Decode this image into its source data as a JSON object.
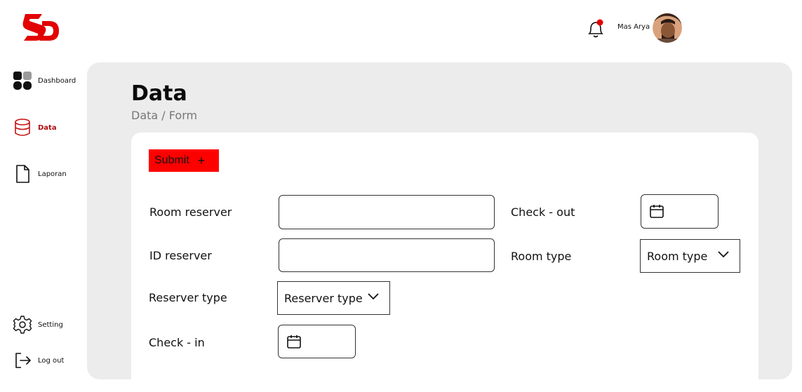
{
  "brand": {
    "logo_icon": "brand-logo",
    "accent": "#e20000"
  },
  "topbar": {
    "bell_icon": "bell-icon",
    "user_name": "Mas Arya",
    "avatar": "avatar"
  },
  "sidebar": {
    "items": [
      {
        "label": "Dashboard",
        "icon": "dashboard-grid-icon",
        "active": false
      },
      {
        "label": "Data",
        "icon": "database-icon",
        "active": true
      },
      {
        "label": "Laporan",
        "icon": "document-icon",
        "active": false
      },
      {
        "label": "Setting",
        "icon": "gear-icon",
        "active": false
      },
      {
        "label": "Log out",
        "icon": "logout-icon",
        "active": false
      }
    ]
  },
  "main": {
    "title": "Data",
    "breadcrumb": "Data / Form"
  },
  "form": {
    "submit_label": "Submit",
    "submit_icon": "plus-icon",
    "room_reserver_label": "Room reserver",
    "room_reserver_value": "",
    "id_reserver_label": "ID reserver",
    "id_reserver_value": "",
    "reserver_type_label": "Reserver type",
    "reserver_type_value": "Reserver type",
    "check_in_label": "Check - in",
    "check_out_label": "Check - out",
    "room_type_label": "Room type",
    "room_type_value": "Room type"
  }
}
